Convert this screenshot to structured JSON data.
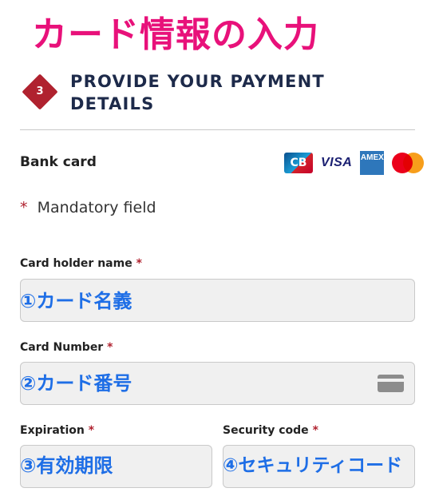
{
  "banner": {
    "title": "カード情報の入力"
  },
  "section": {
    "step_number": "3",
    "title": "PROVIDE YOUR PAYMENT DETAILS"
  },
  "bank_card": {
    "label": "Bank card",
    "logos": {
      "cb": "CB",
      "visa": "VISA",
      "amex": "AMEX"
    }
  },
  "mandatory": {
    "star": "*",
    "text": "Mandatory field"
  },
  "fields": {
    "holder_name": {
      "label": "Card holder name",
      "star": "*",
      "annotation": "①カード名義"
    },
    "card_number": {
      "label": "Card Number",
      "star": "*",
      "annotation": "②カード番号"
    },
    "expiration": {
      "label": "Expiration",
      "star": "*",
      "annotation": "③有効期限"
    },
    "security_code": {
      "label": "Security code",
      "star": "*",
      "annotation": "④セキュリティコード"
    }
  },
  "colors": {
    "accent": "#e8117a",
    "badge": "#b0222f",
    "annotation": "#1e6ee6",
    "title": "#1d2a4a"
  }
}
